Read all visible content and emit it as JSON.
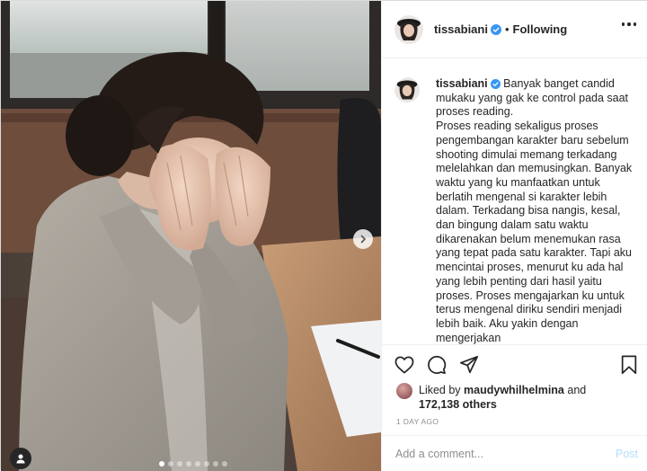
{
  "post": {
    "author": {
      "username": "tissabiani",
      "verified": true,
      "follow_status": "Following"
    },
    "caption": {
      "username": "tissabiani",
      "paragraphs": [
        "Banyak banget candid mukaku yang gak ke control pada saat proses reading.",
        "Proses reading sekaligus proses pengembangan karakter baru sebelum shooting dimulai memang terkadang melelahkan dan memusingkan. Banyak waktu yang ku manfaatkan untuk berlatih mengenal si karakter lebih dalam. Terkadang bisa nangis, kesal, dan bingung dalam satu waktu dikarenakan belum menemukan rasa yang tepat pada satu karakter. Tapi aku mencintai proses, menurut ku ada hal yang lebih penting dari hasil yaitu proses. Proses mengajarkan ku untuk terus mengenal diriku sendiri menjadi lebih baik. Aku yakin dengan mengerjakan"
      ]
    },
    "likes": {
      "prefix": "Liked by",
      "first_user": "maudywhilhelmina",
      "conjunction": "and",
      "others": "172,138 others"
    },
    "timestamp": "1 DAY AGO",
    "comment": {
      "placeholder": "Add a comment...",
      "post_label": "Post"
    },
    "carousel": {
      "total": 8,
      "active_index": 0
    },
    "icons": {
      "like": "heart-icon",
      "comment": "comment-icon",
      "share": "paper-plane-icon",
      "save": "bookmark-icon",
      "more": "more-options-icon",
      "next": "chevron-right-icon",
      "tags": "user-tag-icon",
      "verified": "verified-badge-icon"
    },
    "colors": {
      "verified": "#3897f0",
      "post_button": "#b2dffc",
      "muted_text": "#8e8e8e"
    }
  }
}
